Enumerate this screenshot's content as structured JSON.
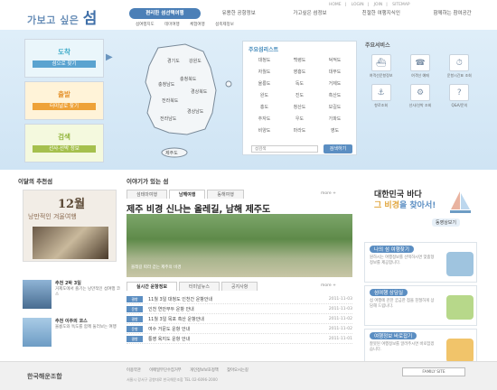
{
  "header": {
    "logo_small": "가보고 싶은",
    "logo_big": "섬",
    "topmenu": [
      "HOME",
      "LOGIN",
      "JOIN",
      "SITEMAP"
    ],
    "gnb": [
      "편리한 섬선택여행",
      "유용한 공항정보",
      "가고싶은 섬정보",
      "친절한 여행지식인",
      "함께하는 참여공간"
    ],
    "subnav": [
      "섬여행지도",
      "테마여행",
      "체험여행",
      "섬축제정보"
    ]
  },
  "quick": [
    {
      "title": "도착",
      "sub": "섬으로 찾기"
    },
    {
      "title": "출발",
      "sub": "터미널로 찾기"
    },
    {
      "title": "검색",
      "sub": "선사·선박 정보"
    }
  ],
  "map_regions": [
    "경기도",
    "강원도",
    "충청북도",
    "충청남도",
    "경상북도",
    "전라북도",
    "경상남도",
    "전라남도",
    "제주도"
  ],
  "island_list": {
    "title": "주요섬리스트",
    "items": [
      "대청도",
      "백령도",
      "덕적도",
      "자월도",
      "영흥도",
      "대부도",
      "울릉도",
      "독도",
      "거제도",
      "완도",
      "진도",
      "흑산도",
      "홍도",
      "청산도",
      "보길도",
      "추자도",
      "우도",
      "가파도",
      "비양도",
      "마라도",
      "영도"
    ],
    "search_placeholder": "섬검색",
    "search_button": "검색하기"
  },
  "services": {
    "title": "주요서비스",
    "items": [
      "여객선운항정보",
      "여객선 예매",
      "운항시간표 조회",
      "항로조회",
      "선사/선박 조회",
      "Q&A/문의"
    ]
  },
  "recommend": {
    "title": "이달의 추천섬",
    "poster_month": "12월",
    "poster_caption": "낭만적인 겨울여행",
    "items": [
      {
        "title": "추천 2박 3일",
        "desc": "거제도에서 즐기는 낭만적인 섬여행 코스"
      },
      {
        "title": "추천 이주의 코스",
        "desc": "울릉도와 독도를 함께 둘러보는 여행"
      }
    ]
  },
  "story": {
    "section_title": "이야기가 있는 섬",
    "tabs": [
      "섬테마여행",
      "남해여행",
      "동해여행"
    ],
    "more": "more +",
    "headline": "제주 비경 신나는 올레길, 남해 제주도",
    "image_caption": "올레길 따라 걷는 제주의 비경"
  },
  "news": {
    "tabs": [
      "실시간 운항정보",
      "터미널뉴스",
      "공지사항"
    ],
    "items": [
      {
        "tag": "결항",
        "title": "11월 3일 대청도 인천간 운항안내",
        "date": "2011-11-03"
      },
      {
        "tag": "운항",
        "title": "인천 연안부두 운항 안내",
        "date": "2011-11-03"
      },
      {
        "tag": "결항",
        "title": "11월 3일 목포 흑산 운항안내",
        "date": "2011-11-02"
      },
      {
        "tag": "운항",
        "title": "여수 거문도 운항 안내",
        "date": "2011-11-02"
      },
      {
        "tag": "결항",
        "title": "통영 욕지도 운항 안내",
        "date": "2011-11-01"
      }
    ]
  },
  "banner": {
    "line1": "대한민국 바다",
    "line2_pre": "그 비경",
    "line2_post": "을 찾아서!",
    "tv": "동영상보기"
  },
  "side_boxes": [
    {
      "head": "나의 섬 여행찾기",
      "desc": "원하시는 여행정보를 선택하시면 맞춤형 정보를 제공합니다.",
      "color": "#9fc4df"
    },
    {
      "head": "섬여행 상담실",
      "desc": "섬 여행에 관한 궁금한 점을 친절하게 상담해 드립니다.",
      "color": "#b7d88a"
    },
    {
      "head": "여행정보 바로잡기",
      "desc": "잘못된 여행정보를 알려주시면 바로잡겠습니다.",
      "color": "#f1c46a"
    }
  ],
  "footer": {
    "logo": "한국해운조합",
    "links": [
      "이용약관",
      "이메일무단수집거부",
      "개인정보보호정책",
      "찾아오시는길"
    ],
    "address": "서울시 강서구 공항대로 한국해운조합 TEL 02-6096-2000",
    "family": "FAMILY SITE"
  }
}
